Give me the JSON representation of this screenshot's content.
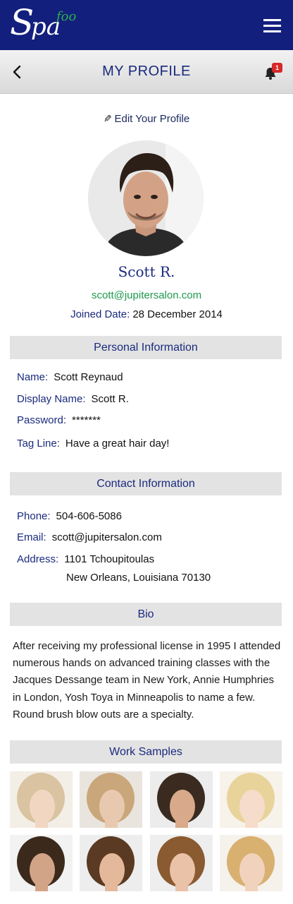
{
  "app": {
    "logo": {
      "big_letter": "S",
      "rest": "pa",
      "tagline": "foo"
    },
    "notifications_count": "1"
  },
  "header": {
    "title": "MY PROFILE"
  },
  "profile": {
    "edit_label": "Edit Your Profile",
    "name": "Scott R.",
    "email": "scott@jupitersalon.com",
    "joined_label": "Joined Date:",
    "joined_value": "28 December 2014"
  },
  "personal": {
    "title": "Personal Information",
    "name_label": "Name:",
    "name_value": "Scott Reynaud",
    "display_label": "Display Name:",
    "display_value": "Scott R.",
    "password_label": "Password:",
    "password_value": "*******",
    "tagline_label": "Tag Line:",
    "tagline_value": "Have a great hair day!"
  },
  "contact": {
    "title": "Contact Information",
    "phone_label": "Phone:",
    "phone_value": "504-606-5086",
    "email_label": "Email:",
    "email_value": "scott@jupitersalon.com",
    "address_label": "Address:",
    "address_line1": "1101 Tchoupitoulas",
    "address_line2": "New Orleans, Louisiana  70130"
  },
  "bio": {
    "title": "Bio",
    "text": "After receiving my professional license in 1995 I attended numerous hands on advanced training classes with the Jacques Dessange  team in New York, Annie Humphries in London, Yosh Toya in Minneapolis to name a few. Round brush blow outs are a specialty."
  },
  "work_samples": {
    "title": "Work Samples",
    "items": [
      {
        "name": "work-sample-1",
        "hair": "#d9c3a0",
        "skin": "#f1d7c2",
        "bg": "#f3eee6"
      },
      {
        "name": "work-sample-2",
        "hair": "#c9a77a",
        "skin": "#e8c9b0",
        "bg": "#e9e4dd"
      },
      {
        "name": "work-sample-3",
        "hair": "#3a2a20",
        "skin": "#d8a98a",
        "bg": "#ececec"
      },
      {
        "name": "work-sample-4",
        "hair": "#e8d39a",
        "skin": "#f6dccb",
        "bg": "#f7f2ea"
      },
      {
        "name": "work-sample-5",
        "hair": "#3b2a1c",
        "skin": "#d2a487",
        "bg": "#f2f2f2"
      },
      {
        "name": "work-sample-6",
        "hair": "#5a3a22",
        "skin": "#e4b99b",
        "bg": "#ededed"
      },
      {
        "name": "work-sample-7",
        "hair": "#8a5a30",
        "skin": "#e9c2a8",
        "bg": "#eeeeee"
      },
      {
        "name": "work-sample-8",
        "hair": "#d8b070",
        "skin": "#f1d2bd",
        "bg": "#f5f1eb"
      }
    ]
  }
}
